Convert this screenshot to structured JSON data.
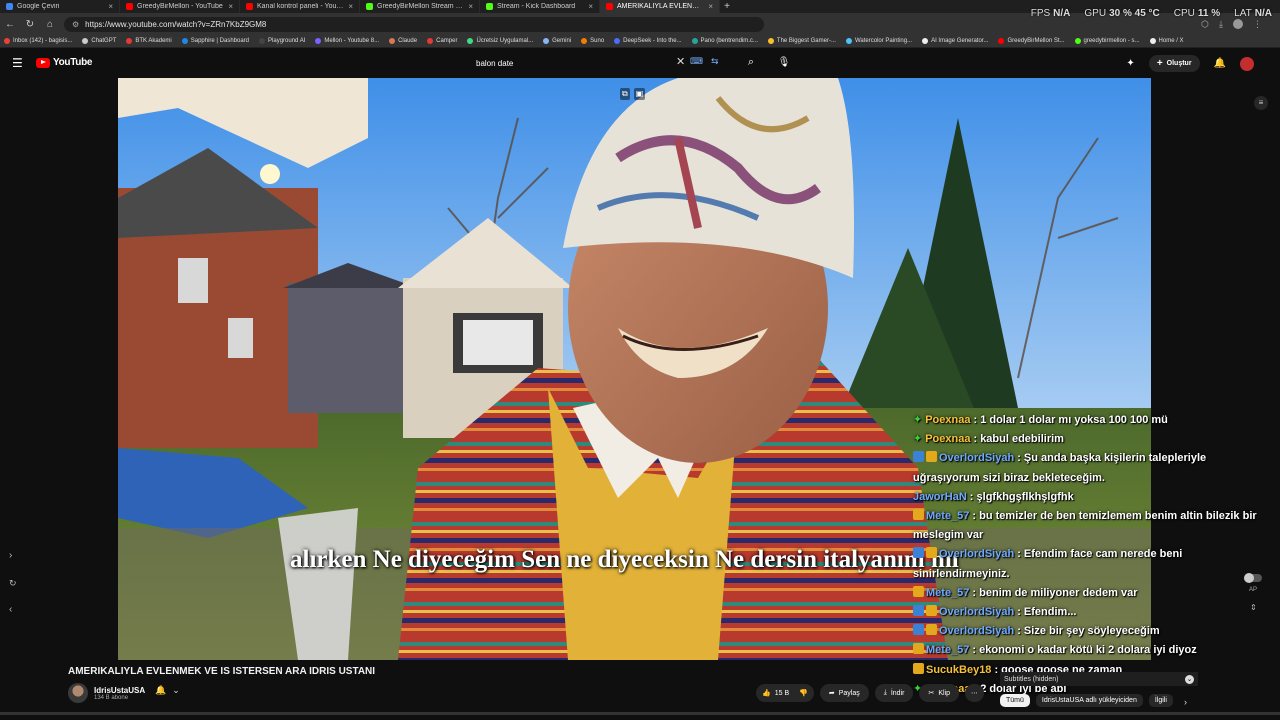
{
  "tabs": [
    {
      "title": "Google Çeviri",
      "color": "#4285f4",
      "active": false
    },
    {
      "title": "GreedyBirMellon - YouTube",
      "color": "#ff0000",
      "active": false
    },
    {
      "title": "Kanal kontrol paneli - YouTube St",
      "color": "#ff0000",
      "active": false
    },
    {
      "title": "GreedyBirMellon Stream - Watch",
      "color": "#53fc18",
      "active": false
    },
    {
      "title": "Stream - Kick Dashboard",
      "color": "#53fc18",
      "active": false
    },
    {
      "title": "AMERIKALIYLA EVLENMEK VE IS",
      "color": "#ff0000",
      "active": true
    }
  ],
  "hud": {
    "fps_label": "FPS",
    "fps_value": "N/A",
    "gpu_label": "GPU",
    "gpu_value": "30 % 45 °C",
    "cpu_label": "CPU",
    "cpu_value": "11 %",
    "lat_label": "LAT",
    "lat_value": "N/A"
  },
  "browser": {
    "url": "https://www.youtube.com/watch?v=ZRn7KbZ9GM8"
  },
  "bookmarks": [
    {
      "label": "Inbox (142) - bagisis...",
      "color": "#ea4335"
    },
    {
      "label": "ChatGPT",
      "color": "#cccccc"
    },
    {
      "label": "BTK Akademi",
      "color": "#e53935"
    },
    {
      "label": "Sapphire | Dashboard",
      "color": "#1e88e5"
    },
    {
      "label": "Playground AI",
      "color": "#444444"
    },
    {
      "label": "Mellon - Youtube 8...",
      "color": "#7b61ff"
    },
    {
      "label": "Claude",
      "color": "#d97757"
    },
    {
      "label": "Camper",
      "color": "#e53935"
    },
    {
      "label": "Ücretsiz Uygulamal...",
      "color": "#3ddc84"
    },
    {
      "label": "Gemini",
      "color": "#8ab4f8"
    },
    {
      "label": "Suno",
      "color": "#f57c00"
    },
    {
      "label": "DeepSeek - Into the...",
      "color": "#4d6bfe"
    },
    {
      "label": "Pano (bentrendim.c...",
      "color": "#26a69a"
    },
    {
      "label": "The Biggest Gamer-...",
      "color": "#fbc02d"
    },
    {
      "label": "Watercolor Painting...",
      "color": "#4fc3f7"
    },
    {
      "label": "AI Image Generator...",
      "color": "#eeeeee"
    },
    {
      "label": "GreedyBirMellon St...",
      "color": "#ff0000"
    },
    {
      "label": "greedybirmellon - s...",
      "color": "#53fc18"
    },
    {
      "label": "Home / X",
      "color": "#eeeeee"
    }
  ],
  "youtube": {
    "logo_text": "YouTube",
    "search_query": "balon date",
    "create_label": "Oluştur"
  },
  "video": {
    "subtitle": "alırken Ne diyeceğim Sen ne diyeceksin Ne dersin italyanım mı",
    "title": "AMERIKALIYLA EVLENMEK VE IS ISTERSEN ARA IDRIS USTANI",
    "channel_name": "IdrisUstaUSA",
    "channel_subs": "134 B abone"
  },
  "chat": [
    {
      "badges": [
        "star"
      ],
      "user": "Poexnaa",
      "user_color": "#f6c23a",
      "text": ": 1 dolar 1 dolar mı yoksa 100 100 mü"
    },
    {
      "badges": [
        "star"
      ],
      "user": "Poexnaa",
      "user_color": "#f6c23a",
      "text": ": kabul edebilirim"
    },
    {
      "badges": [
        "blue",
        "gold"
      ],
      "user": "OverlordSiyah",
      "user_color": "#6fa8ff",
      "text": ": Şu anda başka kişilerin talepleriyle uğraşıyorum sizi biraz bekleteceğim."
    },
    {
      "badges": [],
      "user": "JaworHaN",
      "user_color": "#6fa8ff",
      "text": ": şlgfkhgşflkhşlgfhk"
    },
    {
      "badges": [
        "gold"
      ],
      "user": "Mete_57",
      "user_color": "#6fa8ff",
      "text": ": bu temizler de ben temizlemem benim altin bilezik bir meslegim var"
    },
    {
      "badges": [
        "blue",
        "gold"
      ],
      "user": "OverlordSiyah",
      "user_color": "#6fa8ff",
      "text": ": Efendim face cam nerede beni sinirlendirmeyiniz."
    },
    {
      "badges": [
        "gold"
      ],
      "user": "Mete_57",
      "user_color": "#6fa8ff",
      "text": ": benim de miliyoner dedem var"
    },
    {
      "badges": [
        "blue",
        "gold"
      ],
      "user": "OverlordSiyah",
      "user_color": "#6fa8ff",
      "text": ": Efendim..."
    },
    {
      "badges": [
        "blue",
        "gold"
      ],
      "user": "OverlordSiyah",
      "user_color": "#6fa8ff",
      "text": ": Size bir şey söyleyeceğim"
    },
    {
      "badges": [
        "gold"
      ],
      "user": "Mete_57",
      "user_color": "#6fa8ff",
      "text": ": ekonomi o kadar kötü ki 2 dolara iyi diyoz"
    },
    {
      "badges": [
        "gold"
      ],
      "user": "SucukBey18",
      "user_color": "#f6c23a",
      "text": ": goose goose ne zaman"
    },
    {
      "badges": [
        "star"
      ],
      "user": "Poexnaa",
      "user_color": "#f6c23a",
      "text": ": 2 dolar iyi be abi"
    }
  ],
  "actions": {
    "like_count": "15 B",
    "share": "Paylaş",
    "download": "İndir",
    "clip": "Klip"
  },
  "side": {
    "subtitles_hidden": "Subtitles (hidden)",
    "autoplay_label": "AP",
    "chips": [
      {
        "label": "Tümü",
        "active": true
      },
      {
        "label": "IdrisUstaUSA adlı yükleyiciden",
        "active": false
      },
      {
        "label": "İlgili",
        "active": false
      }
    ]
  }
}
